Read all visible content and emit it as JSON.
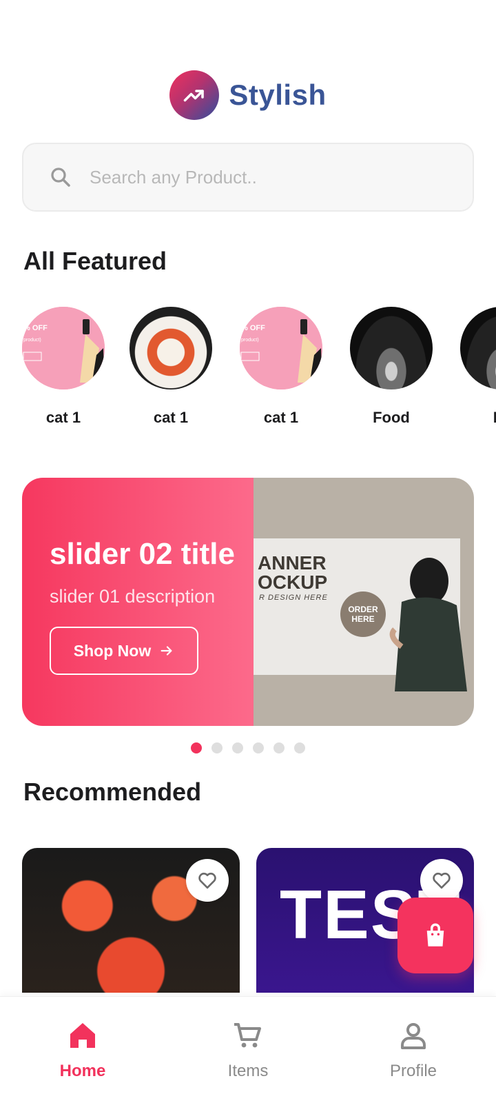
{
  "header": {
    "brand": "Stylish",
    "logo_icon": "trending-up-icon"
  },
  "search": {
    "placeholder": "Search any Product..",
    "value": "",
    "icon": "search-icon"
  },
  "featured": {
    "title": "All Featured",
    "items": [
      {
        "label": "cat 1",
        "image": "promo-sale-image"
      },
      {
        "label": "cat 1",
        "image": "sushi-image"
      },
      {
        "label": "cat 1",
        "image": "promo-sale-image"
      },
      {
        "label": "Food",
        "image": "forest-path-image"
      },
      {
        "label": "Dr",
        "image": "forest-path-image"
      }
    ]
  },
  "slider": {
    "title": "slider 02 title",
    "description": "slider 01 description",
    "button_label": "Shop Now",
    "banner": {
      "heading_line1": "ANNER",
      "heading_line2": "OCKUP",
      "subheading": "R DESIGN HERE",
      "order_text": "ORDER HERE"
    },
    "dot_count": 6,
    "active_index": 0
  },
  "recommended": {
    "title": "Recommended",
    "items": [
      {
        "image": "sushi-image",
        "favorite": false
      },
      {
        "image": "test-banner-image",
        "image_text": "TEST",
        "favorite": false
      }
    ]
  },
  "fab": {
    "icon": "shopping-bag-icon"
  },
  "bottom_nav": {
    "items": [
      {
        "label": "Home",
        "icon": "home-icon",
        "active": true
      },
      {
        "label": "Items",
        "icon": "cart-icon",
        "active": false
      },
      {
        "label": "Profile",
        "icon": "user-icon",
        "active": false
      }
    ]
  },
  "colors": {
    "accent": "#f2325c",
    "brand_text": "#3a5596",
    "inactive": "#8a8a8a"
  }
}
